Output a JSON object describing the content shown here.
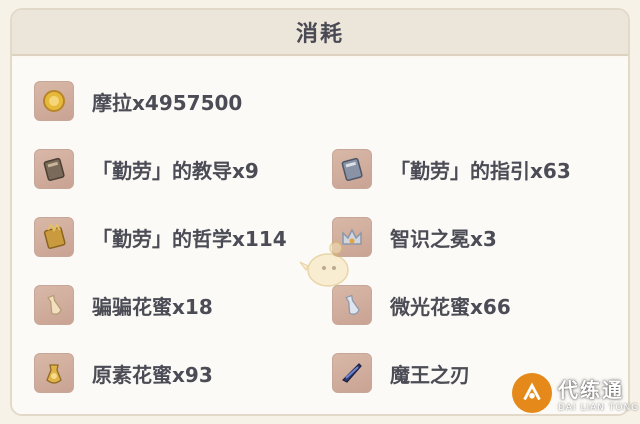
{
  "panel": {
    "title": "消耗"
  },
  "items": [
    {
      "label": "摩拉x4957500",
      "icon": "mora-coin-icon"
    },
    {
      "label": "「勤劳」的教导x9",
      "icon": "teaching-book-icon"
    },
    {
      "label": "「勤劳」的指引x63",
      "icon": "guide-book-icon"
    },
    {
      "label": "「勤劳」的哲学x114",
      "icon": "philosophy-book-icon"
    },
    {
      "label": "智识之冕x3",
      "icon": "crown-icon"
    },
    {
      "label": "骗骗花蜜x18",
      "icon": "nectar-icon"
    },
    {
      "label": "微光花蜜x66",
      "icon": "shimmering-nectar-icon"
    },
    {
      "label": "原素花蜜x93",
      "icon": "energy-nectar-icon"
    },
    {
      "label": "魔王之刃",
      "icon": "tyrant-blade-icon"
    }
  ],
  "watermark": {
    "main": "代练通",
    "sub": "DAI LIAN TONG"
  }
}
